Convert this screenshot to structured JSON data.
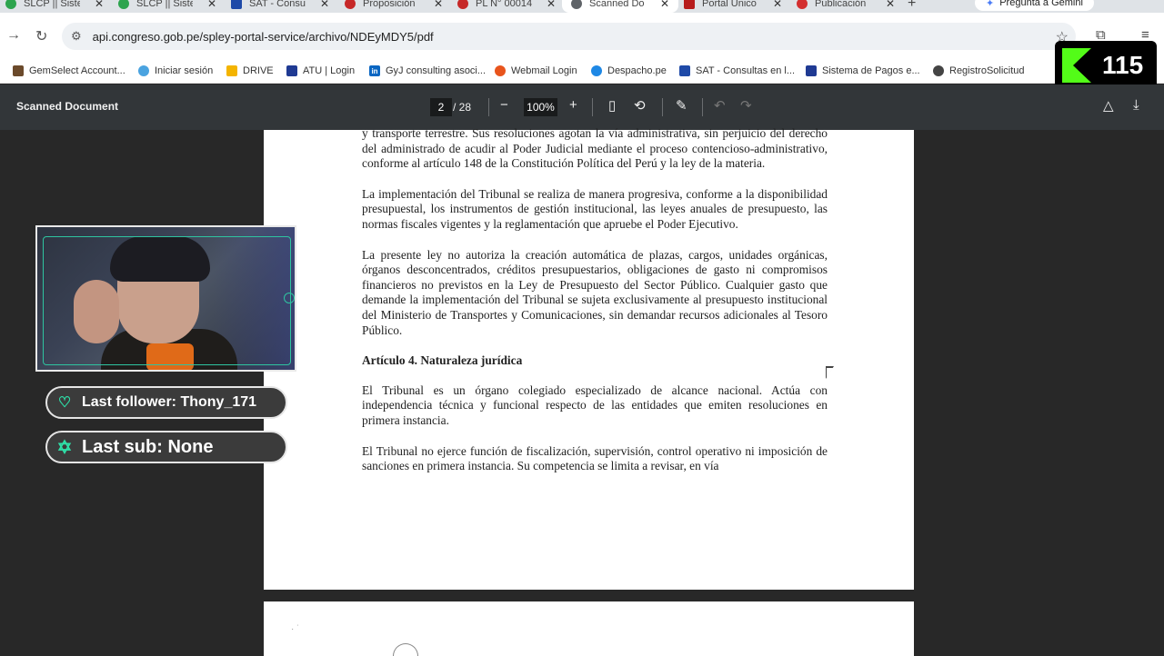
{
  "browser": {
    "tabs": [
      {
        "label": "SLCP || Sistem",
        "icon_color": "#2da44e"
      },
      {
        "label": "SLCP || Sistem",
        "icon_color": "#2da44e"
      },
      {
        "label": "SAT - Consul",
        "icon_color": "#1f4aa8"
      },
      {
        "label": "Proposición",
        "icon_color": "#c62828"
      },
      {
        "label": "PL N° 00014",
        "icon_color": "#c62828"
      },
      {
        "label": "Scanned Do",
        "icon_color": "#5f6368"
      },
      {
        "label": "Portal Único",
        "icon_color": "#b71c1c"
      },
      {
        "label": "Publicación",
        "icon_color": "#d32f2f"
      }
    ],
    "gemini_button": "Pregunta a Gemini",
    "url": "api.congreso.gob.pe/spley-portal-service/archivo/NDEyMDY5/pdf",
    "bookmarks": [
      {
        "label": "GemSelect Account...",
        "icon_color": "#6b4a2b"
      },
      {
        "label": "Iniciar sesión",
        "icon_color": "#4aa3e0"
      },
      {
        "label": "DRIVE",
        "icon_color": "#f4b400"
      },
      {
        "label": "ATU | Login",
        "icon_color": "#1f3a93"
      },
      {
        "label": "GyJ consulting asoci...",
        "icon_color": "#0a66c2"
      },
      {
        "label": "Webmail Login",
        "icon_color": "#e8541c"
      },
      {
        "label": "Despacho.pe",
        "icon_color": "#1e88e5"
      },
      {
        "label": "SAT - Consultas en l...",
        "icon_color": "#1f4aa8"
      },
      {
        "label": "Sistema de Pagos e...",
        "icon_color": "#1f3a93"
      },
      {
        "label": "RegistroSolicitud",
        "icon_color": "#444444"
      }
    ]
  },
  "viewer_badge": {
    "count": "115",
    "brand_color": "#53fc18"
  },
  "pdf": {
    "title": "Scanned Document",
    "current_page": "2",
    "total_pages": "/ 28",
    "zoom": "100%",
    "paragraphs": [
      "y transporte terrestre. Sus resoluciones agotan la vía administrativa, sin perjuicio del derecho del administrado de acudir al Poder Judicial mediante el proceso contencioso-administrativo, conforme al artículo 148 de la Constitución Política del Perú y la ley de la materia.",
      "La implementación del Tribunal se realiza de manera progresiva, conforme a la disponibilidad presupuestal, los instrumentos de gestión institucional, las leyes anuales de presupuesto, las normas fiscales vigentes y la reglamentación que apruebe el Poder Ejecutivo.",
      "La presente ley no autoriza la creación automática de plazas, cargos, unidades orgánicas, órganos desconcentrados, créditos presupuestarios, obligaciones de gasto ni compromisos financieros no previstos en la Ley de Presupuesto del Sector Público. Cualquier gasto que demande la implementación del Tribunal se sujeta exclusivamente al presupuesto institucional del Ministerio de Transportes y Comunicaciones, sin demandar recursos adicionales al Tesoro Público."
    ],
    "article_heading": "Artículo 4. Naturaleza jurídica",
    "article_paragraphs": [
      "El Tribunal es un órgano colegiado especializado de alcance nacional. Actúa con independencia técnica y funcional respecto de las entidades que emiten resoluciones en primera instancia.",
      "El Tribunal no ejerce función de fiscalización, supervisión, control operativo ni imposición de sanciones en primera instancia. Su competencia se limita a revisar, en vía"
    ]
  },
  "overlay": {
    "last_follower": "Last follower: Thony_171",
    "last_sub": "Last sub: None",
    "accent_color": "#2ee0a8"
  }
}
